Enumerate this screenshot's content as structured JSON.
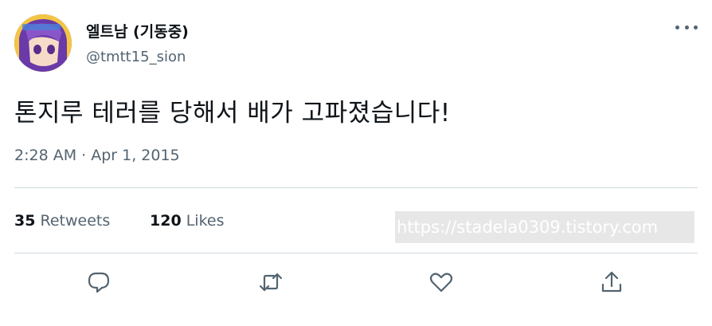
{
  "user": {
    "display_name": "엘트남 (기동중)",
    "handle": "@tmtt15_sion",
    "avatar_icon": "anime-avatar-icon"
  },
  "tweet": {
    "text": "톤지루 테러를 당해서 배가 고파졌습니다!",
    "timestamp": "2:28 AM · Apr 1, 2015"
  },
  "stats": {
    "retweets_count": "35",
    "retweets_label": "Retweets",
    "likes_count": "120",
    "likes_label": "Likes"
  },
  "watermark": {
    "text": "https://stadela0309.tistory.com"
  },
  "actions": {
    "icons": [
      "reply-icon",
      "retweet-icon",
      "like-icon",
      "share-icon"
    ]
  },
  "colors": {
    "text_primary": "#0f1419",
    "text_secondary": "#536471",
    "divider": "#cfd9de",
    "icon": "#536471"
  }
}
